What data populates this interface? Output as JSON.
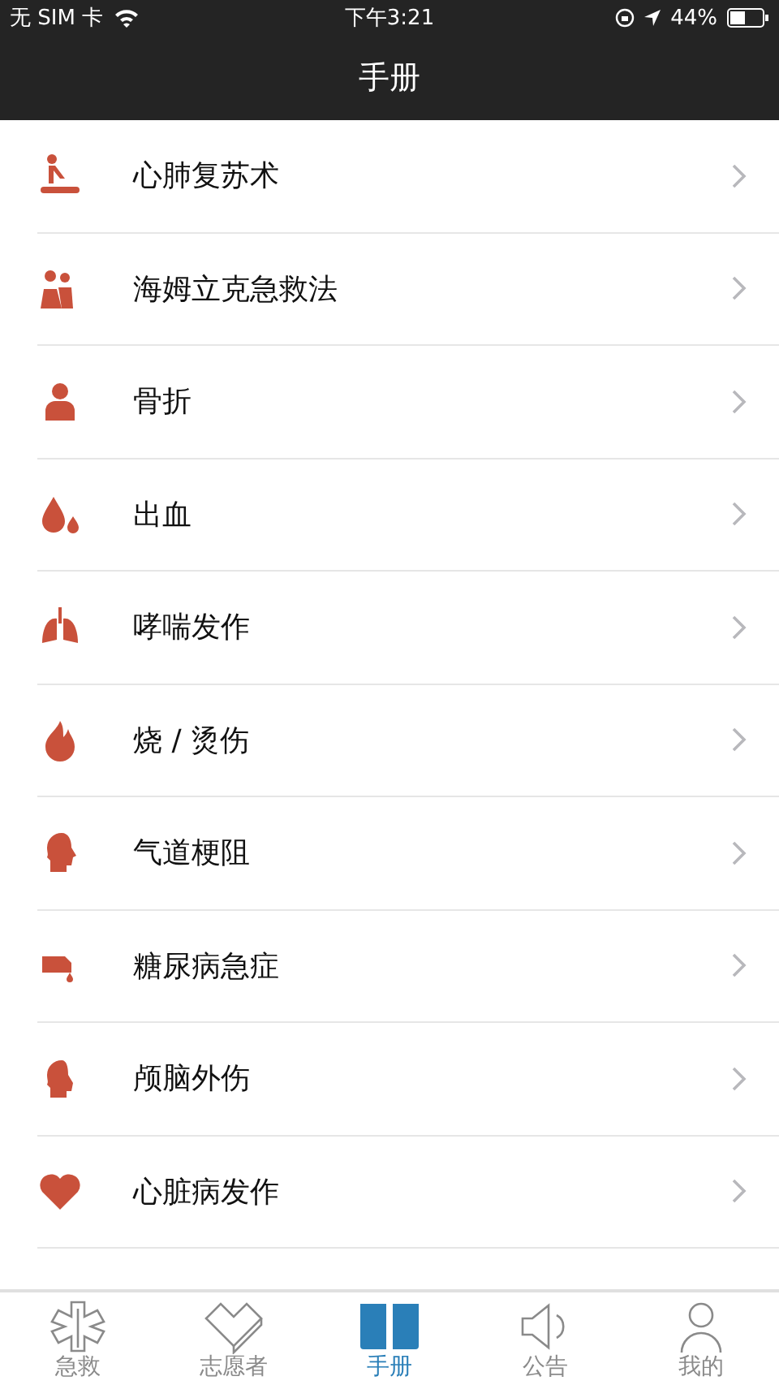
{
  "status_bar": {
    "carrier": "无 SIM 卡",
    "time": "下午3:21",
    "battery": "44%"
  },
  "nav_bar": {
    "title": "手册"
  },
  "items": [
    {
      "label": "心肺复苏术"
    },
    {
      "label": "海姆立克急救法"
    },
    {
      "label": "骨折"
    },
    {
      "label": "出血"
    },
    {
      "label": "哮喘发作"
    },
    {
      "label": "烧 / 烫伤"
    },
    {
      "label": "气道梗阻"
    },
    {
      "label": "糖尿病急症"
    },
    {
      "label": "颅脑外伤"
    },
    {
      "label": "心脏病发作"
    }
  ],
  "tabs": [
    {
      "label": "急救",
      "selected": false
    },
    {
      "label": "志愿者",
      "selected": false
    },
    {
      "label": "手册",
      "selected": true
    },
    {
      "label": "公告",
      "selected": false
    },
    {
      "label": "我的",
      "selected": false
    }
  ]
}
